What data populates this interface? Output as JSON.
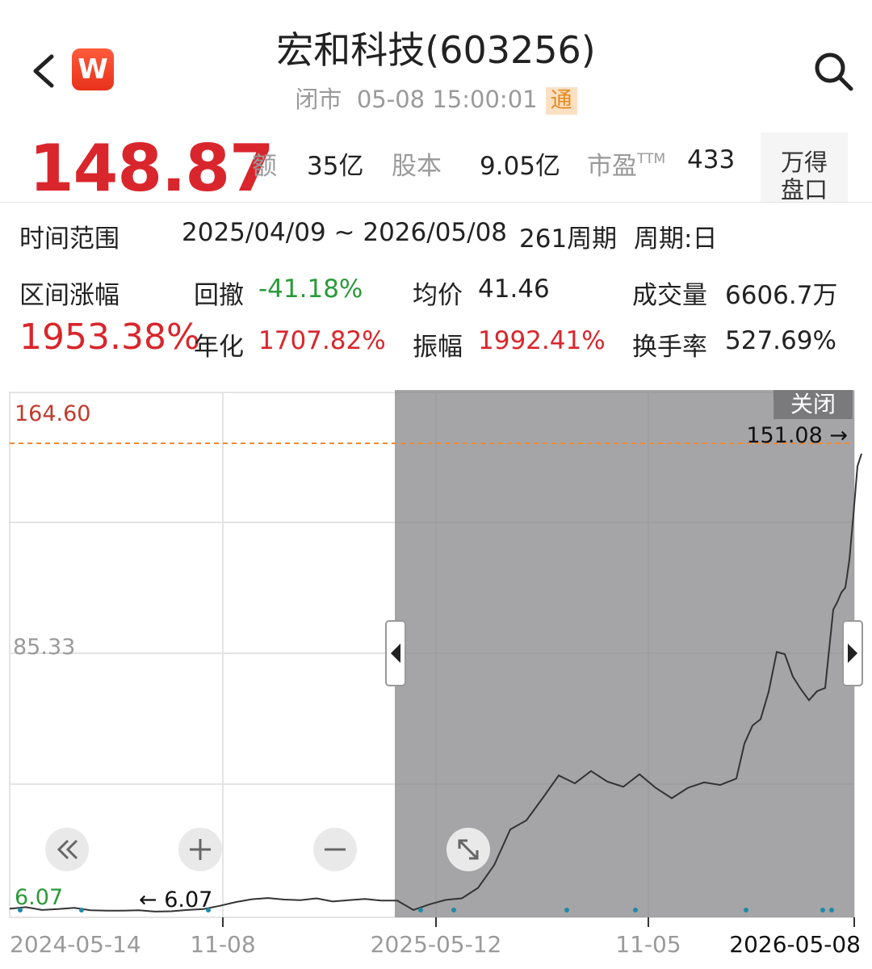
{
  "header": {
    "title": "宏和科技(603256)",
    "status": "闭市",
    "datetime": "05-08 15:00:01",
    "tong_badge": "通",
    "logo_letter": "W"
  },
  "quote": {
    "price": "148.87",
    "amount_label": "额",
    "amount_value": "35亿",
    "share_label": "股本",
    "share_value": "9.05亿",
    "pe_label": "市盈",
    "pe_sup": "TTM",
    "pe_value": "433",
    "pankou_label_1": "万得",
    "pankou_label_2": "盘口"
  },
  "stats": {
    "range_label": "时间范围",
    "range_value": "2025/04/09 ~ 2026/05/08",
    "period_count": "261周期",
    "period_label": "周期:日",
    "change_label": "区间涨幅",
    "change_value": "1953.38%",
    "drawdown_label": "回撤",
    "drawdown_value": "-41.18%",
    "annual_label": "年化",
    "annual_value": "1707.82%",
    "avg_label": "均价",
    "avg_value": "41.46",
    "amplitude_label": "振幅",
    "amplitude_value": "1992.41%",
    "volume_label": "成交量",
    "volume_value": "6606.7万",
    "turnover_label": "换手率",
    "turnover_value": "527.69%"
  },
  "chart_data": {
    "type": "line",
    "y_top_label": "164.60",
    "y_mid_label": "85.33",
    "y_bottom_label": "6.07",
    "ylim": [
      6.07,
      164.6
    ],
    "x_tick_labels": [
      "2024-05-14",
      "11-08",
      "2025-05-12",
      "11-05",
      "2026-05-08"
    ],
    "max_annotation": "151.08 →",
    "min_annotation": "← 6.07",
    "close_label": "关闭",
    "series": [
      {
        "x": [
          0,
          20,
          40,
          60,
          80,
          100,
          120,
          140,
          160,
          180,
          200,
          220,
          240,
          260,
          280,
          300,
          320,
          340,
          360,
          380,
          400,
          420,
          440,
          460,
          480,
          500,
          520,
          540,
          560,
          580,
          600,
          620,
          640,
          660,
          680,
          700,
          720,
          740,
          760,
          780,
          800,
          820,
          840,
          860,
          880,
          900,
          910,
          920,
          930,
          940,
          950,
          960,
          970,
          980,
          990,
          1000,
          1010,
          1020,
          1025,
          1030,
          1035,
          1040,
          1045,
          1050,
          1055
        ],
        "values": [
          7.0,
          7.5,
          6.6,
          6.9,
          7.3,
          6.5,
          6.4,
          6.4,
          6.5,
          6.1,
          6.2,
          6.6,
          6.9,
          7.9,
          9.1,
          10.0,
          10.4,
          9.9,
          9.7,
          10.3,
          9.3,
          9.7,
          10.1,
          9.6,
          9.6,
          6.6,
          8.4,
          9.8,
          10.3,
          13.6,
          20.8,
          32.1,
          35.0,
          42.0,
          49.2,
          46.7,
          50.6,
          47.3,
          45.6,
          49.6,
          45.3,
          42.0,
          45.3,
          47.0,
          46.2,
          48.2,
          59.3,
          65.0,
          67.0,
          75.7,
          88.3,
          87.6,
          80.5,
          76.5,
          73.0,
          75.9,
          76.9,
          101.7,
          104.1,
          107.1,
          108.7,
          117.5,
          131.8,
          147.1,
          151.1
        ]
      }
    ],
    "grid": true
  }
}
